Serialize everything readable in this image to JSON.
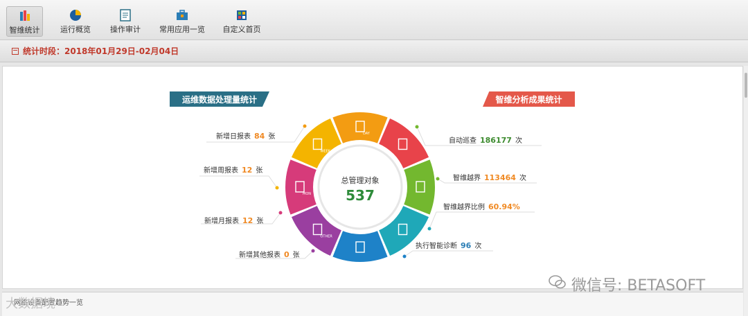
{
  "toolbar": {
    "items": [
      {
        "label": "智维统计",
        "icon": "stats-icon",
        "active": true
      },
      {
        "label": "运行概览",
        "icon": "pie-chart-icon"
      },
      {
        "label": "操作审计",
        "icon": "document-audit-icon"
      },
      {
        "label": "常用应用一览",
        "icon": "briefcase-icon"
      },
      {
        "label": "自定义首页",
        "icon": "custom-home-icon"
      }
    ]
  },
  "period": {
    "text": "统计时段：2018年01月29日-02月04日"
  },
  "sections": {
    "left_title": "运维数据处理量统计",
    "right_title": "智维分析成果统计"
  },
  "donut": {
    "center_title": "总管理对象",
    "center_value": "537",
    "segments": [
      {
        "name": "search",
        "color": "#e8434a",
        "icon": "magnifier-icon"
      },
      {
        "name": "timer",
        "color": "#73b82f",
        "icon": "stopwatch-icon"
      },
      {
        "name": "folder",
        "color": "#1fa8b8",
        "icon": "folder-icon"
      },
      {
        "name": "medical",
        "color": "#1e82c8",
        "icon": "medkit-icon"
      },
      {
        "name": "other",
        "color": "#9a3fa0",
        "icon": "doc-icon",
        "text": "OTHER"
      },
      {
        "name": "mon",
        "color": "#d63b7a",
        "icon": "doc-icon",
        "text": "MON"
      },
      {
        "name": "week",
        "color": "#f4b400",
        "icon": "doc-icon",
        "text": "WEEK"
      },
      {
        "name": "day",
        "color": "#f39c12",
        "icon": "doc-icon",
        "text": "DAY"
      }
    ]
  },
  "left_stats": [
    {
      "label": "新增日报表",
      "value": "84",
      "unit": "张"
    },
    {
      "label": "新增周报表",
      "value": "12",
      "unit": "张"
    },
    {
      "label": "新增月报表",
      "value": "12",
      "unit": "张"
    },
    {
      "label": "新增其他报表",
      "value": "0",
      "unit": "张"
    }
  ],
  "right_stats": [
    {
      "label": "自动巡查",
      "value": "186177",
      "unit": "次"
    },
    {
      "label": "智维越界",
      "value": "113464",
      "unit": "次"
    },
    {
      "label": "智维越界比例",
      "value": "60.94%",
      "unit": ""
    },
    {
      "label": "执行智能诊断",
      "value": "96",
      "unit": "次"
    }
  ],
  "bottom": {
    "label": "网络设备配置趋势一览"
  },
  "watermarks": {
    "right": "微信号: BETASOFT",
    "left": "大数据境"
  }
}
